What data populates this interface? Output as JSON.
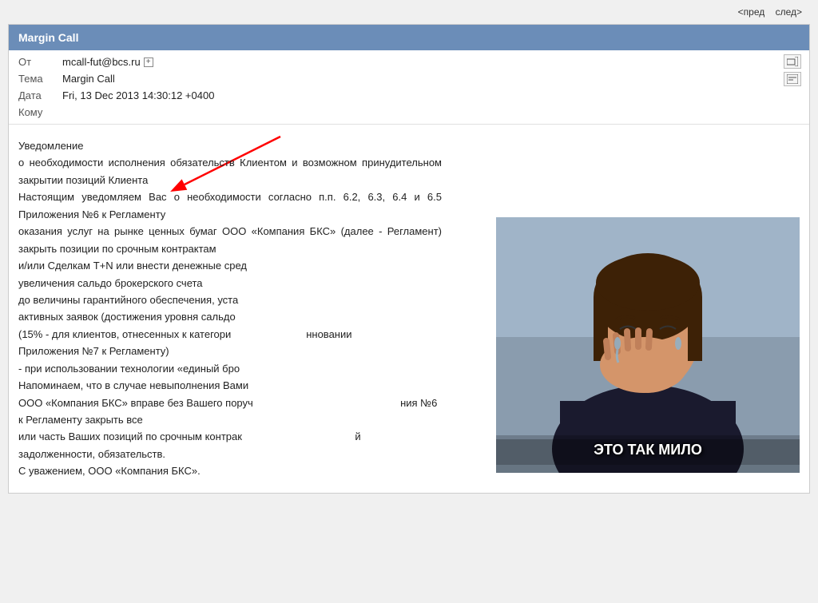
{
  "nav": {
    "prev_label": "<пред",
    "next_label": "след>"
  },
  "email": {
    "header_title": "Margin Call",
    "from_label": "От",
    "from_value": "mcall-fut@bcs.ru",
    "subject_label": "Тема",
    "subject_value": "Margin Call",
    "date_label": "Дата",
    "date_value": "Fri, 13 Dec 2013 14:30:12 +0400",
    "to_label": "Кому",
    "to_value": "",
    "body_lines": [
      "Уведомление",
      "о необходимости исполнения обязательств Клиентом и возможном принудительном закрытии позиций Клиента",
      "Настоящим уведомляем Вас о необходимости согласно п.п. 6.2, 6.3, 6.4 и 6.5 Приложения №6 к Регламенту",
      "оказания услуг на рынке ценных бумаг ООО «Компания БКС» (далее - Регламент) закрыть позиции по срочным контрактам",
      "и/или Сделкам Т+N или внести денежные сред",
      "увеличения сальдо брокерского счета",
      "до величины гарантийного обеспечения, уста",
      "активных заявок (достижения уровня сальдо",
      "(15% - для клиентов, отнесенных к категори",
      "Приложения №7 к Регламенту)",
      "- при использовании технологии «единый бро",
      "Напоминаем, что в случае невыполнения Вами",
      "ООО «Компания БКС» вправе без Вашего поруч",
      "к Регламенту закрыть все",
      "или часть Ваших позиций по срочным контрак",
      "задолженности, обязательств.",
      "С уважением, ООО «Компания БКС»."
    ],
    "meme_caption": "ЭТО ТАК МИЛО"
  }
}
